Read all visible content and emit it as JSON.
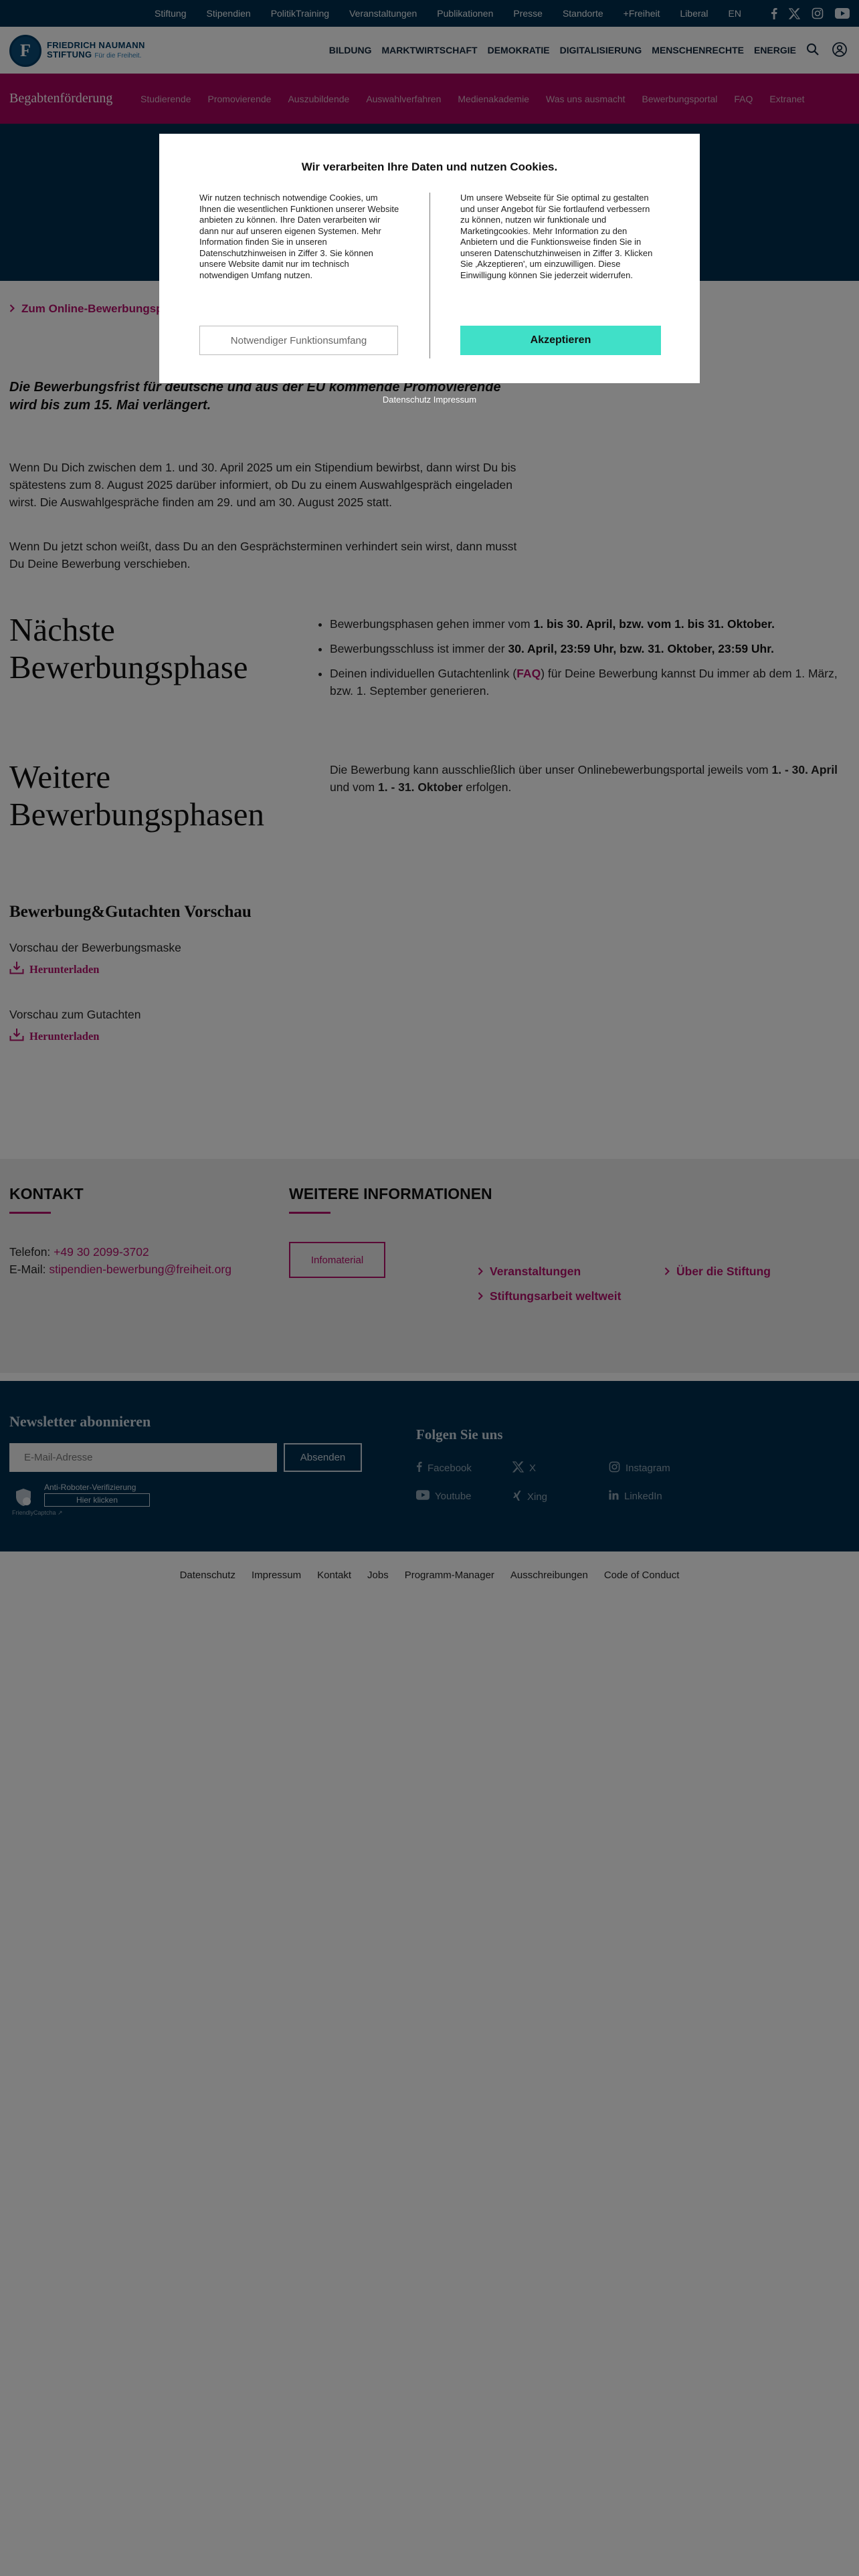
{
  "topbar": {
    "links": [
      "Stiftung",
      "Stipendien",
      "PolitikTraining",
      "Veranstaltungen",
      "Publikationen",
      "Presse",
      "Standorte",
      "+Freiheit",
      "Liberal",
      "EN"
    ]
  },
  "header": {
    "logo_line1": "FRIEDRICH NAUMANN",
    "logo_line2": "STIFTUNG",
    "logo_tagline": "Für die Freiheit.",
    "nav": [
      "BILDUNG",
      "MARKTWIRTSCHAFT",
      "DEMOKRATIE",
      "DIGITALISIERUNG",
      "MENSCHENRECHTE",
      "ENERGIE"
    ]
  },
  "subnav": {
    "title": "Begabtenförderung",
    "items": [
      "Studierende",
      "Promovierende",
      "Auszubildende",
      "Auswahlverfahren",
      "Medienakademie",
      "Was uns ausmacht",
      "Bewerbungsportal",
      "FAQ",
      "Extranet"
    ]
  },
  "content": {
    "portal_link": "Zum Online-Bewerbungsportal",
    "notice": "Die Bewerbungsfrist für deutsche und aus der EU kommende Promovierende wird bis zum 15. Mai verlängert.",
    "para1": "Wenn Du Dich zwischen dem 1. und 30. April 2025 um ein Stipendium bewirbst, dann wirst Du bis spätestens zum 8. August 2025 darüber informiert, ob Du zu einem Auswahlgespräch eingeladen wirst. Die Auswahlgespräche finden am 29. und am 30. August 2025 statt.",
    "para2": "Wenn Du jetzt schon weißt, dass Du an den Gesprächsterminen verhindert sein wirst, dann musst Du Deine Bewerbung verschieben.",
    "next_phase_title_1": "Nächste",
    "next_phase_title_2": "Bewerbungsphase",
    "bullet1_a": "Bewerbungsphasen gehen immer vom ",
    "bullet1_b": "1. bis 30. April, bzw. vom 1. bis 31. Oktober.",
    "bullet2_a": "Bewerbungsschluss ist immer der ",
    "bullet2_b": "30. April, 23:59 Uhr, bzw. 31. Oktober, 23:59 Uhr.",
    "bullet3_a": "Deinen individuellen Gutachtenlink (",
    "bullet3_faq": "FAQ",
    "bullet3_b": ") für Deine Bewerbung kannst Du immer ab dem 1. März, bzw. 1. September generieren.",
    "more_phases_title_1": "Weitere",
    "more_phases_title_2": "Bewerbungsphasen",
    "more_a": "Die Bewerbung kann ausschließlich über unser Onlinebewerbungsportal jeweils vom ",
    "more_b": "1. - 30. April",
    "more_c": " und vom ",
    "more_d": "1. - 31. Oktober",
    "more_e": " erfolgen.",
    "preview_title": "Bewerbung&Gutachten Vorschau",
    "preview1_label": "Vorschau der Bewerbungsmaske",
    "preview2_label": "Vorschau zum Gutachten",
    "download_label": "Herunterladen"
  },
  "contact": {
    "title": "KONTAKT",
    "phone_label": "Telefon: ",
    "phone": "+49 30 2099-3702",
    "email_label": "E-Mail: ",
    "email": "stipendien-bewerbung@freiheit.org",
    "more_title": "WEITERE INFORMATIONEN",
    "info_button": "Infomaterial",
    "links": [
      "Veranstaltungen",
      "Über die Stiftung",
      "Stiftungsarbeit weltweit"
    ]
  },
  "newsletter": {
    "title": "Newsletter abonnieren",
    "placeholder": "E-Mail-Adresse",
    "submit": "Absenden",
    "captcha_title": "Anti-Roboter-Verifizierung",
    "captcha_button": "Hier klicken",
    "captcha_brand": "FriendlyCaptcha ↗",
    "follow_title": "Folgen Sie uns",
    "social": [
      "Facebook",
      "X",
      "Instagram",
      "Youtube",
      "Xing",
      "LinkedIn"
    ]
  },
  "footer": {
    "links": [
      "Datenschutz",
      "Impressum",
      "Kontakt",
      "Jobs",
      "Programm-Manager",
      "Ausschreibungen",
      "Code of Conduct"
    ]
  },
  "cookie": {
    "title": "Wir verarbeiten Ihre Daten und nutzen Cookies.",
    "left_text": "Wir nutzen technisch notwendige Cookies, um Ihnen die wesentlichen Funktionen unserer Website anbieten zu können. Ihre Daten verarbeiten wir dann nur auf unseren eigenen Systemen. Mehr Information finden Sie in unseren Datenschutzhinweisen in Ziffer 3. Sie können unsere Website damit nur im technisch notwendigen Umfang nutzen.",
    "right_text": "Um unsere Webseite für Sie optimal zu gestalten und unser Angebot für Sie fortlaufend verbessern zu können, nutzen wir funktionale und Marketingcookies. Mehr Information zu den Anbietern und die Funktionsweise finden Sie in unseren Datenschutzhinweisen in Ziffer 3. Klicken Sie ‚Akzeptieren', um einzuwilligen. Diese Einwilligung können Sie jederzeit widerrufen.",
    "btn_necessary": "Notwendiger Funktionsumfang",
    "btn_accept": "Akzeptieren",
    "link_privacy": "Datenschutz",
    "link_imprint": "Impressum"
  },
  "colors": {
    "navy": "#002f4e",
    "magenta": "#a4045c",
    "accent_link": "#b3106a",
    "accept": "#40e0c8"
  }
}
